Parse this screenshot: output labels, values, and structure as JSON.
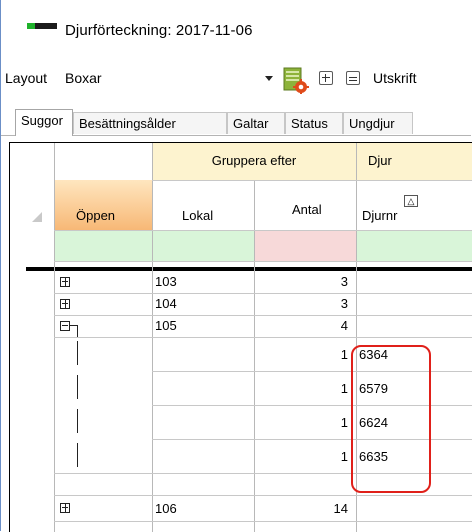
{
  "window": {
    "title": "Djurförteckning: 2017-11-06",
    "icon": "app-icon"
  },
  "toolbar": {
    "layout_label": "Layout",
    "layout_value": "Boxar",
    "layout_icon": "layout-settings-icon",
    "expand_icon": "expand-all-icon",
    "collapse_icon": "collapse-all-icon",
    "print_label": "Utskrift"
  },
  "tabs": [
    {
      "label": "Suggor",
      "active": true
    },
    {
      "label": "Besättningsålder",
      "active": false
    },
    {
      "label": "Galtar",
      "active": false
    },
    {
      "label": "Status",
      "active": false
    },
    {
      "label": "Ungdjur",
      "active": false
    }
  ],
  "grid": {
    "band_group": "Gruppera efter",
    "band_djur": "Djur",
    "columns": {
      "oppen": "Öppen",
      "lokal": "Lokal",
      "antal": "Antal",
      "djurnr": "Djurnr"
    },
    "rows": [
      {
        "level": "group",
        "expanded": false,
        "lokal": "103",
        "antal": "3",
        "djurnr": ""
      },
      {
        "level": "group",
        "expanded": false,
        "lokal": "104",
        "antal": "3",
        "djurnr": ""
      },
      {
        "level": "group",
        "expanded": true,
        "lokal": "105",
        "antal": "4",
        "djurnr": ""
      },
      {
        "level": "child",
        "lokal": "",
        "antal": "1",
        "djurnr": "6364"
      },
      {
        "level": "child",
        "lokal": "",
        "antal": "1",
        "djurnr": "6579"
      },
      {
        "level": "child",
        "lokal": "",
        "antal": "1",
        "djurnr": "6624"
      },
      {
        "level": "child",
        "lokal": "",
        "antal": "1",
        "djurnr": "6635"
      },
      {
        "level": "group",
        "expanded": false,
        "lokal": "106",
        "antal": "14",
        "djurnr": ""
      }
    ]
  },
  "colors": {
    "highlight": "#e0201a",
    "header_band": "#fdf3cf",
    "filter_green": "#d9f5d9",
    "filter_red": "#f7d9d9"
  }
}
